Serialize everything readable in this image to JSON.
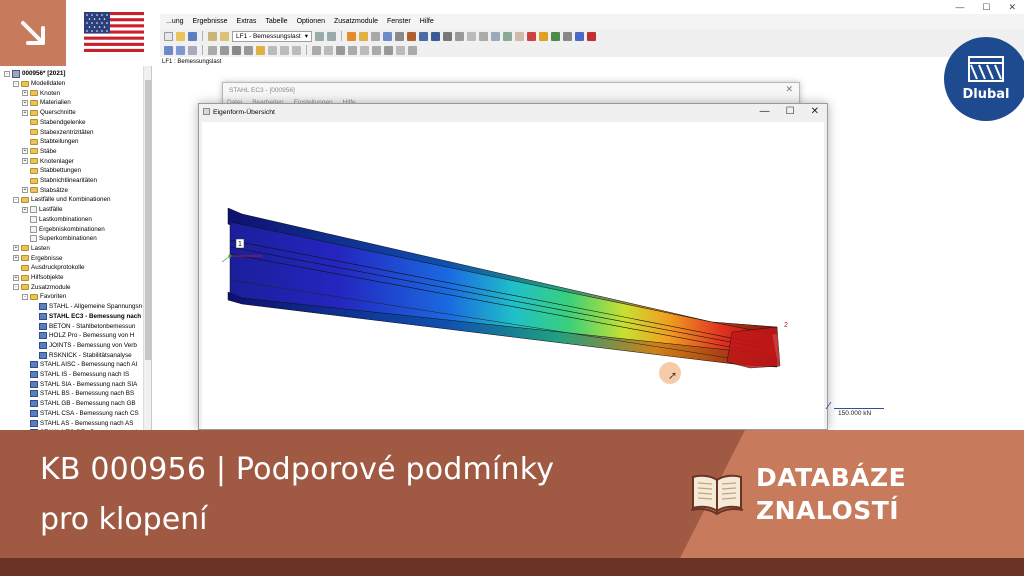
{
  "app": {
    "menu": [
      "...ung",
      "Ergebnisse",
      "Extras",
      "Tabelle",
      "Optionen",
      "Zusatzmodule",
      "Fenster",
      "Hilfe"
    ],
    "load_case_select": "LF1 - Bemessungslast",
    "tab_label": "LF1 : Bemessungslast",
    "window_controls": [
      "—",
      "☐",
      "✕"
    ]
  },
  "navigator": {
    "items": [
      {
        "label": "000956* [2021]",
        "level": 0,
        "icon": "root",
        "exp": "-",
        "bold": true
      },
      {
        "label": "Modelldaten",
        "level": 1,
        "icon": "fold",
        "exp": "-"
      },
      {
        "label": "Knoten",
        "level": 2,
        "icon": "fold",
        "exp": "+"
      },
      {
        "label": "Materialien",
        "level": 2,
        "icon": "fold",
        "exp": "+"
      },
      {
        "label": "Querschnitte",
        "level": 2,
        "icon": "fold",
        "exp": "+"
      },
      {
        "label": "Stabendgelenke",
        "level": 2,
        "icon": "fold",
        "exp": ""
      },
      {
        "label": "Stabexzentrizitäten",
        "level": 2,
        "icon": "fold",
        "exp": ""
      },
      {
        "label": "Stabteilungen",
        "level": 2,
        "icon": "fold",
        "exp": ""
      },
      {
        "label": "Stäbe",
        "level": 2,
        "icon": "fold",
        "exp": "+"
      },
      {
        "label": "Knotenlager",
        "level": 2,
        "icon": "fold",
        "exp": "+"
      },
      {
        "label": "Stabbettungen",
        "level": 2,
        "icon": "fold",
        "exp": ""
      },
      {
        "label": "Stabnichtlinearitäten",
        "level": 2,
        "icon": "fold",
        "exp": ""
      },
      {
        "label": "Stabsätze",
        "level": 2,
        "icon": "fold",
        "exp": "+"
      },
      {
        "label": "Lastfälle und Kombinationen",
        "level": 1,
        "icon": "fold",
        "exp": "-"
      },
      {
        "label": "Lastfälle",
        "level": 2,
        "icon": "doc",
        "exp": "+"
      },
      {
        "label": "Lastkombinationen",
        "level": 2,
        "icon": "doc",
        "exp": ""
      },
      {
        "label": "Ergebniskombinationen",
        "level": 2,
        "icon": "doc",
        "exp": ""
      },
      {
        "label": "Superkombinationen",
        "level": 2,
        "icon": "doc",
        "exp": ""
      },
      {
        "label": "Lasten",
        "level": 1,
        "icon": "fold",
        "exp": "+"
      },
      {
        "label": "Ergebnisse",
        "level": 1,
        "icon": "fold",
        "exp": "+"
      },
      {
        "label": "Ausdruckprotokolle",
        "level": 1,
        "icon": "fold",
        "exp": ""
      },
      {
        "label": "Hilfsobjekte",
        "level": 1,
        "icon": "fold",
        "exp": "+"
      },
      {
        "label": "Zusatzmodule",
        "level": 1,
        "icon": "fold",
        "exp": "-"
      },
      {
        "label": "Favoriten",
        "level": 2,
        "icon": "fold",
        "exp": "-"
      },
      {
        "label": "STAHL - Allgemeine Spannungsn",
        "level": 3,
        "icon": "mod",
        "exp": ""
      },
      {
        "label": "STAHL EC3 - Bemessung nach",
        "level": 3,
        "icon": "mod",
        "exp": "",
        "bold": true
      },
      {
        "label": "BETON - Stahlbetonbemessun",
        "level": 3,
        "icon": "mod",
        "exp": ""
      },
      {
        "label": "HOLZ Pro - Bemessung von H",
        "level": 3,
        "icon": "mod",
        "exp": ""
      },
      {
        "label": "JOINTS - Bemessung von Verb",
        "level": 3,
        "icon": "mod",
        "exp": ""
      },
      {
        "label": "RSKNICK - Stabilitätsanalyse",
        "level": 3,
        "icon": "mod",
        "exp": ""
      },
      {
        "label": "STAHL AISC - Bemessung nach AI",
        "level": 2,
        "icon": "mod",
        "exp": ""
      },
      {
        "label": "STAHL IS - Bemessung nach IS",
        "level": 2,
        "icon": "mod",
        "exp": ""
      },
      {
        "label": "STAHL SIA - Bemessung nach SIA",
        "level": 2,
        "icon": "mod",
        "exp": ""
      },
      {
        "label": "STAHL BS - Bemessung nach BS",
        "level": 2,
        "icon": "mod",
        "exp": ""
      },
      {
        "label": "STAHL GB - Bemessung nach GB",
        "level": 2,
        "icon": "mod",
        "exp": ""
      },
      {
        "label": "STAHL CSA - Bemessung nach CS",
        "level": 2,
        "icon": "mod",
        "exp": ""
      },
      {
        "label": "STAHL AS - Bemessung nach AS",
        "level": 2,
        "icon": "mod",
        "exp": ""
      },
      {
        "label": "STAHL NTC-DF - Bemessung nach",
        "level": 2,
        "icon": "mod",
        "exp": ""
      }
    ]
  },
  "stahl_window": {
    "title": "STAHL EC3 - [000956]",
    "menu": [
      "Datei",
      "Bearbeiten",
      "Einstellungen",
      "Hilfe"
    ],
    "close": "✕"
  },
  "eigen_window": {
    "title": "Eigenform-Übersicht",
    "controls": [
      "—",
      "☐",
      "✕"
    ],
    "node_labels": [
      "1",
      "2"
    ]
  },
  "force_label": "150.000 kN",
  "banner": {
    "title_line1": "KB 000956 | Podporové podmínky",
    "title_line2": "pro klopení",
    "kb_line1": "DATABÁZE",
    "kb_line2": "ZNALOSTÍ",
    "logo_text": "Dlubal"
  },
  "colors": {
    "banner_left": "#a05a44",
    "banner_right": "#c77a5c",
    "banner_strip": "#6a3424",
    "logo_blue": "#1e4b8f"
  }
}
